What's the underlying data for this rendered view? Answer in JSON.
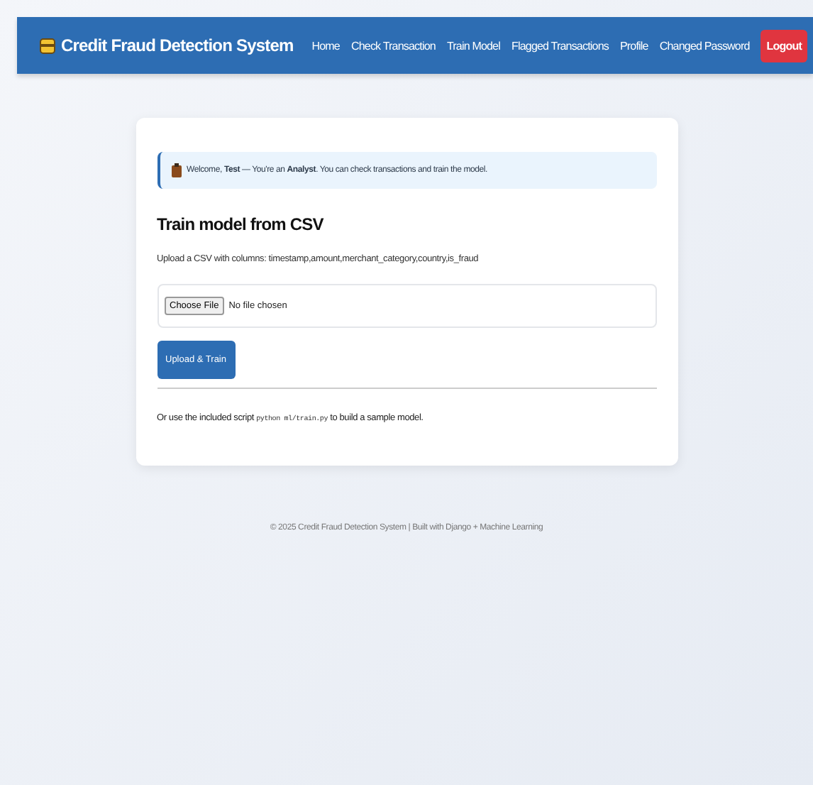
{
  "navbar": {
    "brand": "Credit Fraud Detection System",
    "links": [
      {
        "label": "Home",
        "kind": "link"
      },
      {
        "label": "Check Transaction",
        "kind": "link"
      },
      {
        "label": "Train Model",
        "kind": "link"
      },
      {
        "label": "Flagged Transactions",
        "kind": "link"
      },
      {
        "label": "Profile",
        "kind": "link"
      },
      {
        "label": "Changed Password",
        "kind": "link"
      },
      {
        "label": "Logout",
        "kind": "danger"
      }
    ]
  },
  "alert": {
    "text": "Welcome, **Test** — You're an **Analyst**. You can check transactions and train the model."
  },
  "card": {
    "title": "Train model from CSV",
    "description": "Upload a CSV with columns: timestamp,amount,merchant_category,country,is_fraud",
    "file_input": {
      "button": "Choose File",
      "status": "No file chosen"
    },
    "submit": "Upload & Train",
    "note": {
      "before": "Or use the included script",
      "code": "python ml/train.py",
      "after": "to build a sample model."
    }
  },
  "footer": "© 2025 Credit Fraud Detection System | Built with Django + Machine Learning"
}
